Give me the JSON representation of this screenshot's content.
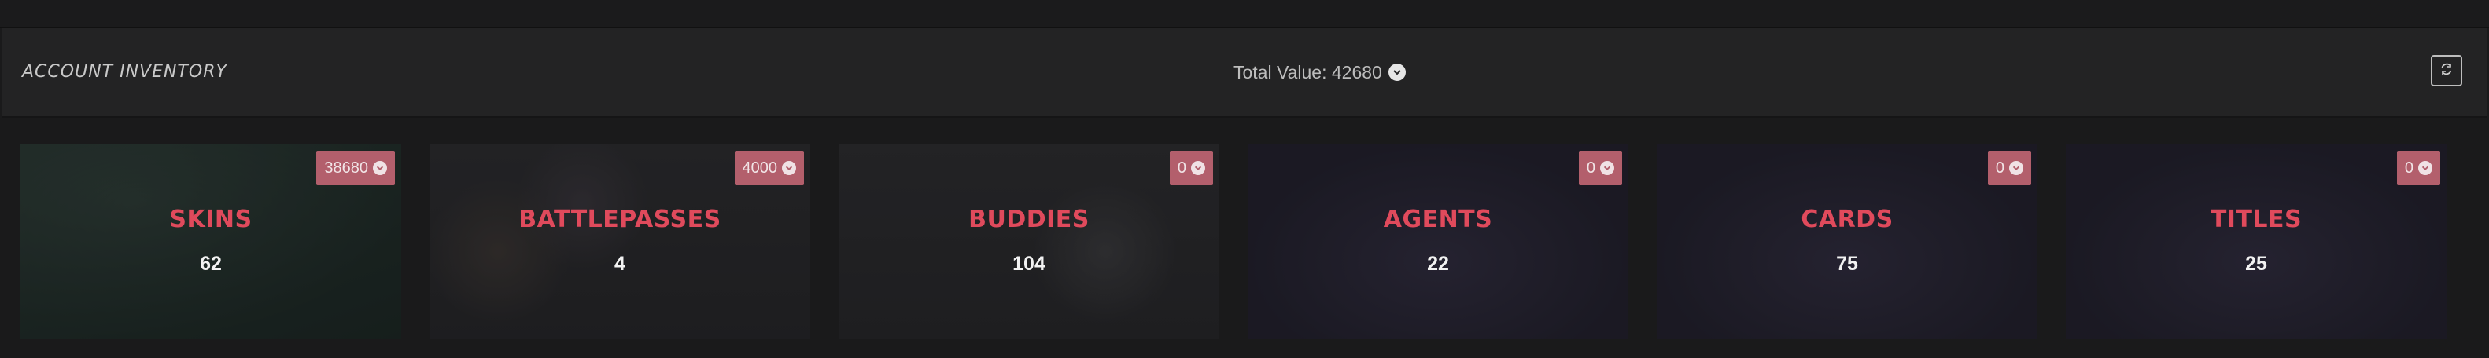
{
  "header": {
    "title": "ACCOUNT INVENTORY",
    "total_value_label": "Total Value: 42680",
    "total_value_icon": "chevron-down-icon",
    "refresh_icon": "refresh-icon"
  },
  "colors": {
    "accent": "#e04a5c",
    "badge": "#b35f6c",
    "header_bg": "#232324"
  },
  "categories": [
    {
      "name": "SKINS",
      "count": "62",
      "value": "38680"
    },
    {
      "name": "BATTLEPASSES",
      "count": "4",
      "value": "4000"
    },
    {
      "name": "BUDDIES",
      "count": "104",
      "value": "0"
    },
    {
      "name": "AGENTS",
      "count": "22",
      "value": "0"
    },
    {
      "name": "CARDS",
      "count": "75",
      "value": "0"
    },
    {
      "name": "TITLES",
      "count": "25",
      "value": "0"
    }
  ]
}
